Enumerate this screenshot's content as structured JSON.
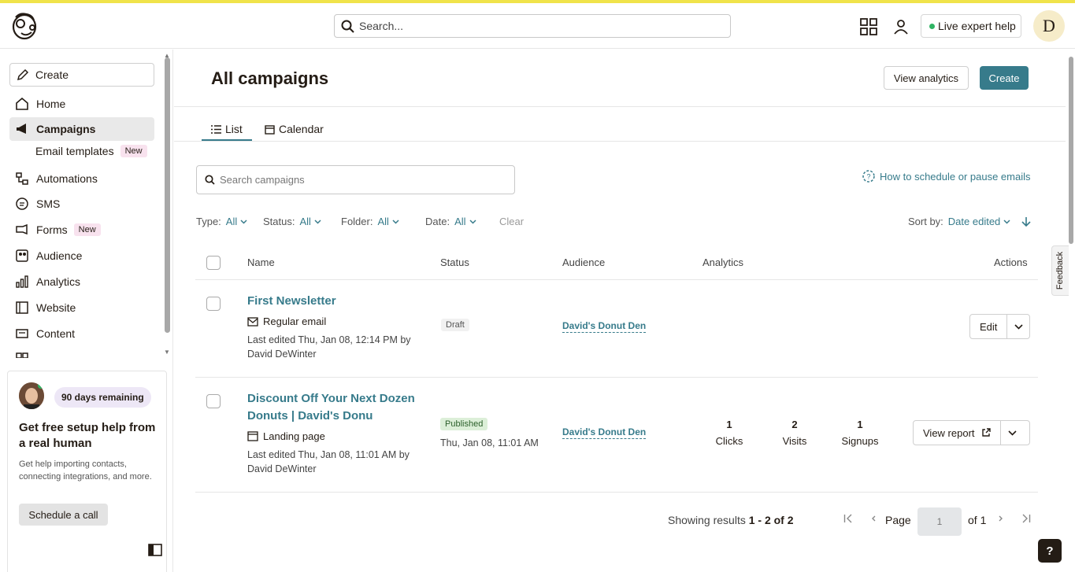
{
  "topbar": {
    "search_placeholder": "Search...",
    "expert_help_label": "Live expert help",
    "avatar_initial": "D"
  },
  "sidebar": {
    "create_label": "Create",
    "items": [
      {
        "label": "Home",
        "icon": "home-icon"
      },
      {
        "label": "Campaigns",
        "icon": "megaphone-icon",
        "active": true
      },
      {
        "label": "Automations",
        "icon": "automation-icon"
      },
      {
        "label": "SMS",
        "icon": "sms-icon"
      },
      {
        "label": "Forms",
        "icon": "forms-icon",
        "badge": "New"
      },
      {
        "label": "Audience",
        "icon": "audience-icon"
      },
      {
        "label": "Analytics",
        "icon": "analytics-icon"
      },
      {
        "label": "Website",
        "icon": "website-icon"
      },
      {
        "label": "Content",
        "icon": "content-icon"
      }
    ],
    "sub_item": {
      "label": "Email templates",
      "badge": "New"
    },
    "promo": {
      "days_badge": "90 days remaining",
      "title": "Get free setup help from a real human",
      "text": "Get help importing contacts, connecting integrations, and more.",
      "button": "Schedule a call"
    }
  },
  "main": {
    "title": "All campaigns",
    "view_analytics": "View analytics",
    "create": "Create",
    "tabs": [
      {
        "label": "List"
      },
      {
        "label": "Calendar"
      }
    ],
    "search_placeholder": "Search campaigns",
    "help_link": "How to schedule or pause emails",
    "filters": [
      {
        "label": "Type:",
        "value": "All"
      },
      {
        "label": "Status:",
        "value": "All"
      },
      {
        "label": "Folder:",
        "value": "All"
      },
      {
        "label": "Date:",
        "value": "All"
      }
    ],
    "clear": "Clear",
    "sort_label": "Sort by:",
    "sort_value": "Date edited",
    "columns": {
      "name": "Name",
      "status": "Status",
      "audience": "Audience",
      "analytics": "Analytics",
      "actions": "Actions"
    },
    "rows": [
      {
        "name": "First Newsletter",
        "type": "Regular email",
        "edited_line1": "Last edited Thu, Jan 08, 12:14 PM by",
        "edited_line2": "David DeWinter",
        "status": "Draft",
        "audience": "David's Donut Den",
        "action": "Edit"
      },
      {
        "name": "Discount Off Your Next Dozen Donuts | David's Donu",
        "type": "Landing page",
        "edited_line1": "Last edited Thu, Jan 08, 11:01 AM by",
        "edited_line2": "David DeWinter",
        "status": "Published",
        "status_date": "Thu, Jan 08, 11:01 AM",
        "audience": "David's Donut Den",
        "stats": [
          {
            "num": "1",
            "label": "Clicks"
          },
          {
            "num": "2",
            "label": "Visits"
          },
          {
            "num": "1",
            "label": "Signups"
          }
        ],
        "action": "View report"
      }
    ],
    "results_prefix": "Showing results ",
    "results_range": "1 - 2 of 2",
    "page_label": "Page",
    "page_value": "1",
    "of_label": "of 1"
  },
  "feedback_label": "Feedback",
  "help_label": "?",
  "colors": {
    "accent": "#377b8b",
    "stripe": "#f0e34a"
  }
}
